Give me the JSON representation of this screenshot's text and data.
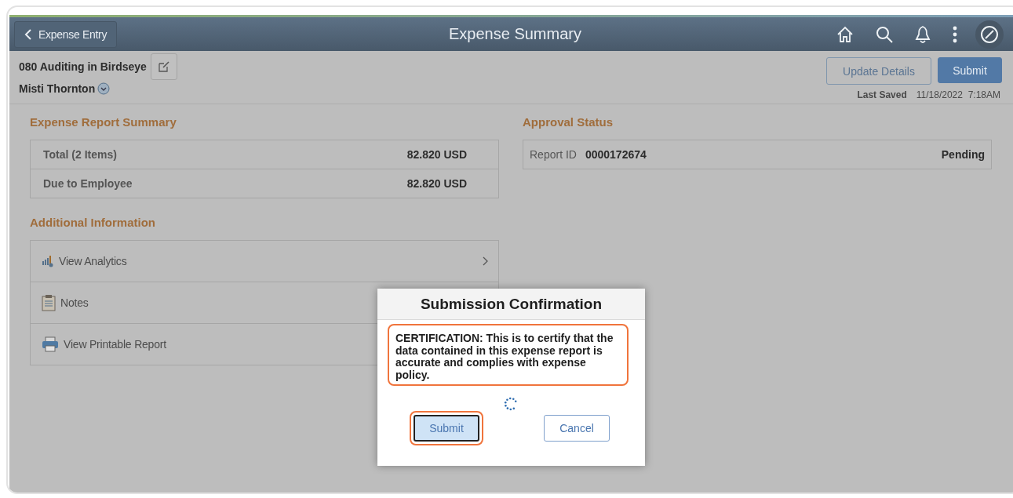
{
  "header": {
    "back_button": "Expense Entry",
    "title": "Expense Summary"
  },
  "report": {
    "title": "080 Auditing in Birdseye",
    "employee": "Misti Thornton"
  },
  "actions": [
    {
      "label": "Update Details",
      "kind": "secondary"
    },
    {
      "label": "Submit",
      "kind": "primary"
    }
  ],
  "last_saved": {
    "label": "Last Saved",
    "value": "11/18/2022  7:18AM"
  },
  "summary": {
    "title": "Expense Report Summary",
    "rows": [
      {
        "label": "Total (2 Items)",
        "value": "82.820 USD"
      },
      {
        "label": "Due to Employee",
        "value": "82.820 USD"
      }
    ]
  },
  "approval": {
    "title": "Approval Status",
    "label": "Report ID",
    "report_id": "0000172674",
    "status": "Pending"
  },
  "additional": {
    "title": "Additional Information",
    "items": [
      {
        "label": "View Analytics",
        "kind": "analytics",
        "chevron": true
      },
      {
        "label": "Notes",
        "kind": "notes"
      },
      {
        "label": "View Printable Report",
        "kind": "print"
      }
    ]
  },
  "dialog": {
    "title": "Submission Confirmation",
    "message": "CERTIFICATION: This is to certify that the data contained in this expense report is accurate and complies with expense policy.",
    "message_highlighted": true,
    "loading": true,
    "buttons": [
      {
        "label": "Submit",
        "kind": "primary",
        "highlighted": true
      },
      {
        "label": "Cancel",
        "kind": "secondary",
        "highlighted": false
      }
    ]
  }
}
